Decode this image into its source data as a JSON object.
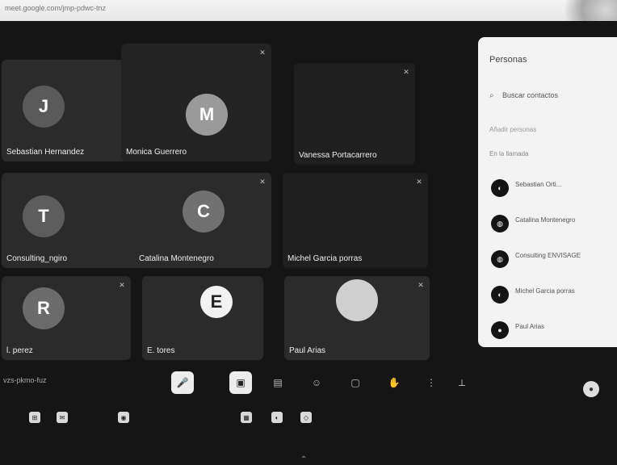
{
  "browser": {
    "url": "meet.google.com/jmp-pdwc-tnz"
  },
  "tiles": [
    {
      "name": "Sebastian Hernandez",
      "initial": "J",
      "avatar_color": "#5a5a5a"
    },
    {
      "name": "Monica Guerrero",
      "initial": "M",
      "avatar_color": "#9a9a9a"
    },
    {
      "name": "Vanessa Portacarrero",
      "initial": "",
      "avatar_color": "#3a3a3a"
    },
    {
      "name": "Consulting_ngiro",
      "initial": "T",
      "avatar_color": "#5d5d5d"
    },
    {
      "name": "Catalina Montenegro",
      "initial": "C",
      "avatar_color": "#707070"
    },
    {
      "name": "Michel Garcia porras",
      "initial": "",
      "avatar_color": "#3e3e3e"
    },
    {
      "name": "l. perez",
      "initial": "R",
      "avatar_color": "#6b6b6b"
    },
    {
      "name": "E. tores",
      "initial": "E",
      "avatar_color": "#f2f2f2"
    },
    {
      "name": "Paul Arias",
      "initial": "",
      "avatar_color": "#cfcfcf"
    }
  ],
  "panel": {
    "title": "Personas",
    "search_placeholder": "Buscar contactos",
    "subtitle": "Añadir personas",
    "section": "En la llamada",
    "people": [
      {
        "name": "Sebastian Orti...",
        "status": ""
      },
      {
        "name": "Catalina Montenegro",
        "status": ""
      },
      {
        "name": "Consulting ENVISAGE",
        "status": ""
      },
      {
        "name": "Michel Garcia porras",
        "status": ""
      },
      {
        "name": "Paul Arias",
        "status": ""
      }
    ]
  },
  "toolbar": {
    "meeting_id": "vzs-pkmo-fuz",
    "mic_icon": "mic-icon",
    "camera_icon": "camera-off-icon",
    "cc_icon": "captions-icon",
    "emoji_icon": "emoji-icon",
    "present_icon": "present-icon",
    "raise_icon": "raise-hand-icon",
    "more_icon": "more-icon",
    "leave_icon": "end-call-icon"
  },
  "taskbar": {
    "time": ""
  }
}
